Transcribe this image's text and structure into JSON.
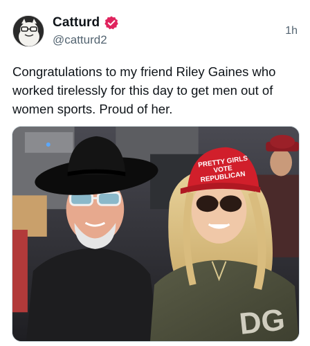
{
  "author": {
    "display_name": "Catturd",
    "handle": "@catturd2",
    "verified": true,
    "avatar_icon": "cartoon-face-avatar"
  },
  "timestamp": "1h",
  "post": {
    "text": "Congratulations to my friend Riley Gaines who worked tirelessly for this day to get men out of women sports. Proud of her."
  },
  "media": {
    "kind": "photo",
    "hat_text": [
      "PRETTY GIRLS",
      "VOTE",
      "REPUBLICAN"
    ]
  },
  "colors": {
    "verified_badge": "#e0245e",
    "text_primary": "#0f1419",
    "text_secondary": "#536471"
  }
}
